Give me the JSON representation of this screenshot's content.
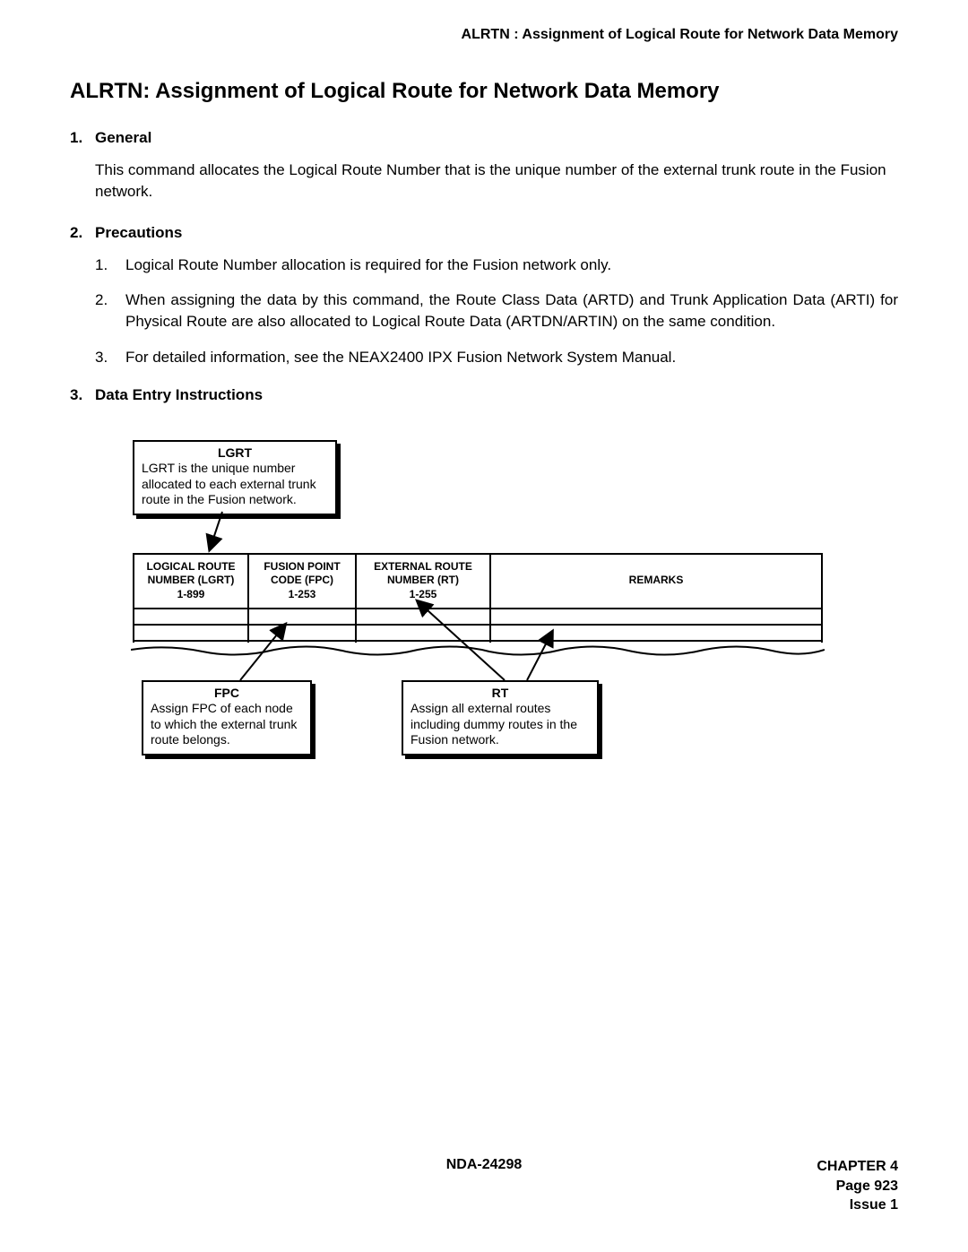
{
  "running_header": "ALRTN : Assignment of Logical Route for Network Data Memory",
  "main_title": "ALRTN: Assignment of Logical Route for Network Data Memory",
  "sections": {
    "s1": {
      "num": "1.",
      "label": "General"
    },
    "s2": {
      "num": "2.",
      "label": "Precautions"
    },
    "s3": {
      "num": "3.",
      "label": "Data Entry Instructions"
    }
  },
  "general_body": "This command allocates the Logical Route Number that is the unique number of the external trunk route in the Fusion network.",
  "precautions": {
    "p1": {
      "num": "1.",
      "text": "Logical Route Number allocation is required for the Fusion network only."
    },
    "p2": {
      "num": "2.",
      "text": "When assigning the data by this command, the Route Class Data (ARTD) and Trunk Application Data (ARTI) for Physical Route are also allocated to Logical Route Data (ARTDN/ARTIN) on the same condition."
    },
    "p3": {
      "num": "3.",
      "text": "For detailed information, see the NEAX2400 IPX Fusion Network System Manual."
    }
  },
  "callouts": {
    "lgrt": {
      "title": "LGRT",
      "text": "LGRT is the unique number allocated to each external trunk route in the Fusion network."
    },
    "fpc": {
      "title": "FPC",
      "text": "Assign FPC of each node to which the external trunk route belongs."
    },
    "rt": {
      "title": "RT",
      "text": "Assign all external routes including dummy routes in the Fusion network."
    }
  },
  "table": {
    "h1a": "LOGICAL ROUTE",
    "h1b": "NUMBER (LGRT)",
    "h1c": "1-899",
    "h2a": "FUSION POINT",
    "h2b": "CODE (FPC)",
    "h2c": "1-253",
    "h3a": "EXTERNAL ROUTE",
    "h3b": "NUMBER (RT)",
    "h3c": "1-255",
    "h4": "REMARKS"
  },
  "footer": {
    "doc_no": "NDA-24298",
    "chapter": "CHAPTER 4",
    "page": "Page 923",
    "issue": "Issue 1"
  }
}
